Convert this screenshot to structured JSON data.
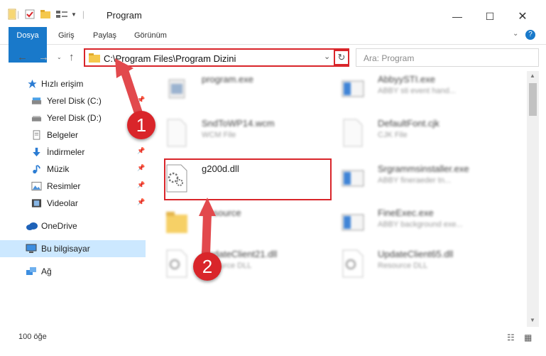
{
  "window": {
    "title": "Program",
    "min_icon": "minimize-icon",
    "max_icon": "maximize-icon",
    "close_icon": "close-icon"
  },
  "ribbon": {
    "tabs": [
      "Dosya",
      "Giriş",
      "Paylaş",
      "Görünüm"
    ]
  },
  "address": {
    "path": "C:\\Program Files\\Program Dizini",
    "search_placeholder": "Ara: Program"
  },
  "sidebar": {
    "items": [
      {
        "label": "Hızlı erişim",
        "icon": "star-icon"
      },
      {
        "label": "Yerel Disk (C:)",
        "icon": "drive-icon",
        "pinned": true
      },
      {
        "label": "Yerel Disk (D:)",
        "icon": "drive-icon"
      },
      {
        "label": "Belgeler",
        "icon": "documents-icon",
        "pinned": true
      },
      {
        "label": "İndirmeler",
        "icon": "download-icon",
        "pinned": true
      },
      {
        "label": "Müzik",
        "icon": "music-icon",
        "pinned": true
      },
      {
        "label": "Resimler",
        "icon": "pictures-icon",
        "pinned": true
      },
      {
        "label": "Videolar",
        "icon": "video-icon",
        "pinned": true
      },
      {
        "label": "OneDrive",
        "icon": "cloud-icon"
      },
      {
        "label": "Bu bilgisayar",
        "icon": "computer-icon",
        "selected": true
      },
      {
        "label": "Ağ",
        "icon": "network-icon"
      }
    ]
  },
  "files": [
    {
      "name": "program.exe",
      "type": ""
    },
    {
      "name": "AbbyySTI.exe",
      "type": "ABBY sti event hand..."
    },
    {
      "name": "SndToWP14.wcm",
      "type": "WCM File"
    },
    {
      "name": "DefaultFont.cjk",
      "type": "CJK File"
    },
    {
      "name": "g200d.dll",
      "type": ""
    },
    {
      "name": "Srgrammsinstaller.exe",
      "type": "ABBY fineraeder tn..."
    },
    {
      "name": "Resource",
      "type": ""
    },
    {
      "name": "FineExec.exe",
      "type": "ABBY background exe..."
    },
    {
      "name": "UpdateClient21.dll",
      "type": "Resource DLL"
    },
    {
      "name": "UpdateClient65.dll",
      "type": "Resource DLL"
    }
  ],
  "status": {
    "count": "100 öğe"
  },
  "annotations": {
    "step1": "1",
    "step2": "2"
  },
  "colors": {
    "accent": "#1979ca",
    "highlight": "#d9252a",
    "selected_bg": "#cce8ff"
  }
}
